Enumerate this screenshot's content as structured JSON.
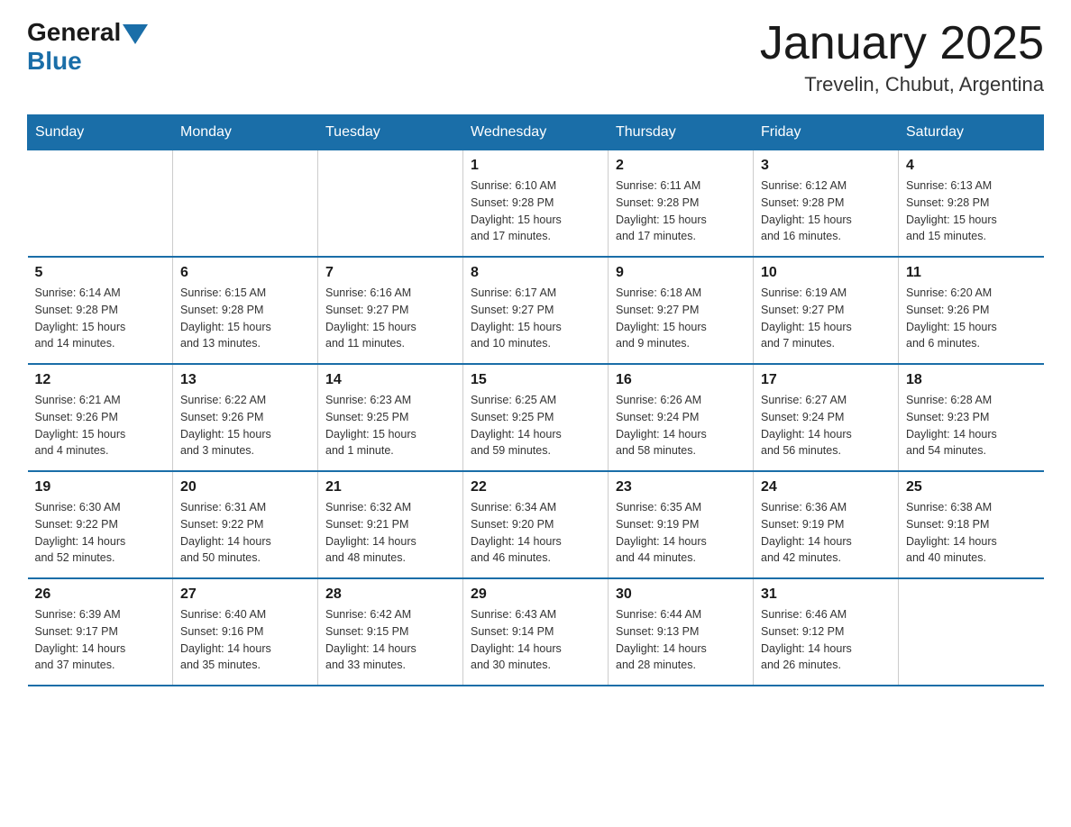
{
  "header": {
    "logo_general": "General",
    "logo_blue": "Blue",
    "title": "January 2025",
    "subtitle": "Trevelin, Chubut, Argentina"
  },
  "days_of_week": [
    "Sunday",
    "Monday",
    "Tuesday",
    "Wednesday",
    "Thursday",
    "Friday",
    "Saturday"
  ],
  "weeks": [
    [
      {
        "day": "",
        "info": ""
      },
      {
        "day": "",
        "info": ""
      },
      {
        "day": "",
        "info": ""
      },
      {
        "day": "1",
        "info": "Sunrise: 6:10 AM\nSunset: 9:28 PM\nDaylight: 15 hours\nand 17 minutes."
      },
      {
        "day": "2",
        "info": "Sunrise: 6:11 AM\nSunset: 9:28 PM\nDaylight: 15 hours\nand 17 minutes."
      },
      {
        "day": "3",
        "info": "Sunrise: 6:12 AM\nSunset: 9:28 PM\nDaylight: 15 hours\nand 16 minutes."
      },
      {
        "day": "4",
        "info": "Sunrise: 6:13 AM\nSunset: 9:28 PM\nDaylight: 15 hours\nand 15 minutes."
      }
    ],
    [
      {
        "day": "5",
        "info": "Sunrise: 6:14 AM\nSunset: 9:28 PM\nDaylight: 15 hours\nand 14 minutes."
      },
      {
        "day": "6",
        "info": "Sunrise: 6:15 AM\nSunset: 9:28 PM\nDaylight: 15 hours\nand 13 minutes."
      },
      {
        "day": "7",
        "info": "Sunrise: 6:16 AM\nSunset: 9:27 PM\nDaylight: 15 hours\nand 11 minutes."
      },
      {
        "day": "8",
        "info": "Sunrise: 6:17 AM\nSunset: 9:27 PM\nDaylight: 15 hours\nand 10 minutes."
      },
      {
        "day": "9",
        "info": "Sunrise: 6:18 AM\nSunset: 9:27 PM\nDaylight: 15 hours\nand 9 minutes."
      },
      {
        "day": "10",
        "info": "Sunrise: 6:19 AM\nSunset: 9:27 PM\nDaylight: 15 hours\nand 7 minutes."
      },
      {
        "day": "11",
        "info": "Sunrise: 6:20 AM\nSunset: 9:26 PM\nDaylight: 15 hours\nand 6 minutes."
      }
    ],
    [
      {
        "day": "12",
        "info": "Sunrise: 6:21 AM\nSunset: 9:26 PM\nDaylight: 15 hours\nand 4 minutes."
      },
      {
        "day": "13",
        "info": "Sunrise: 6:22 AM\nSunset: 9:26 PM\nDaylight: 15 hours\nand 3 minutes."
      },
      {
        "day": "14",
        "info": "Sunrise: 6:23 AM\nSunset: 9:25 PM\nDaylight: 15 hours\nand 1 minute."
      },
      {
        "day": "15",
        "info": "Sunrise: 6:25 AM\nSunset: 9:25 PM\nDaylight: 14 hours\nand 59 minutes."
      },
      {
        "day": "16",
        "info": "Sunrise: 6:26 AM\nSunset: 9:24 PM\nDaylight: 14 hours\nand 58 minutes."
      },
      {
        "day": "17",
        "info": "Sunrise: 6:27 AM\nSunset: 9:24 PM\nDaylight: 14 hours\nand 56 minutes."
      },
      {
        "day": "18",
        "info": "Sunrise: 6:28 AM\nSunset: 9:23 PM\nDaylight: 14 hours\nand 54 minutes."
      }
    ],
    [
      {
        "day": "19",
        "info": "Sunrise: 6:30 AM\nSunset: 9:22 PM\nDaylight: 14 hours\nand 52 minutes."
      },
      {
        "day": "20",
        "info": "Sunrise: 6:31 AM\nSunset: 9:22 PM\nDaylight: 14 hours\nand 50 minutes."
      },
      {
        "day": "21",
        "info": "Sunrise: 6:32 AM\nSunset: 9:21 PM\nDaylight: 14 hours\nand 48 minutes."
      },
      {
        "day": "22",
        "info": "Sunrise: 6:34 AM\nSunset: 9:20 PM\nDaylight: 14 hours\nand 46 minutes."
      },
      {
        "day": "23",
        "info": "Sunrise: 6:35 AM\nSunset: 9:19 PM\nDaylight: 14 hours\nand 44 minutes."
      },
      {
        "day": "24",
        "info": "Sunrise: 6:36 AM\nSunset: 9:19 PM\nDaylight: 14 hours\nand 42 minutes."
      },
      {
        "day": "25",
        "info": "Sunrise: 6:38 AM\nSunset: 9:18 PM\nDaylight: 14 hours\nand 40 minutes."
      }
    ],
    [
      {
        "day": "26",
        "info": "Sunrise: 6:39 AM\nSunset: 9:17 PM\nDaylight: 14 hours\nand 37 minutes."
      },
      {
        "day": "27",
        "info": "Sunrise: 6:40 AM\nSunset: 9:16 PM\nDaylight: 14 hours\nand 35 minutes."
      },
      {
        "day": "28",
        "info": "Sunrise: 6:42 AM\nSunset: 9:15 PM\nDaylight: 14 hours\nand 33 minutes."
      },
      {
        "day": "29",
        "info": "Sunrise: 6:43 AM\nSunset: 9:14 PM\nDaylight: 14 hours\nand 30 minutes."
      },
      {
        "day": "30",
        "info": "Sunrise: 6:44 AM\nSunset: 9:13 PM\nDaylight: 14 hours\nand 28 minutes."
      },
      {
        "day": "31",
        "info": "Sunrise: 6:46 AM\nSunset: 9:12 PM\nDaylight: 14 hours\nand 26 minutes."
      },
      {
        "day": "",
        "info": ""
      }
    ]
  ]
}
